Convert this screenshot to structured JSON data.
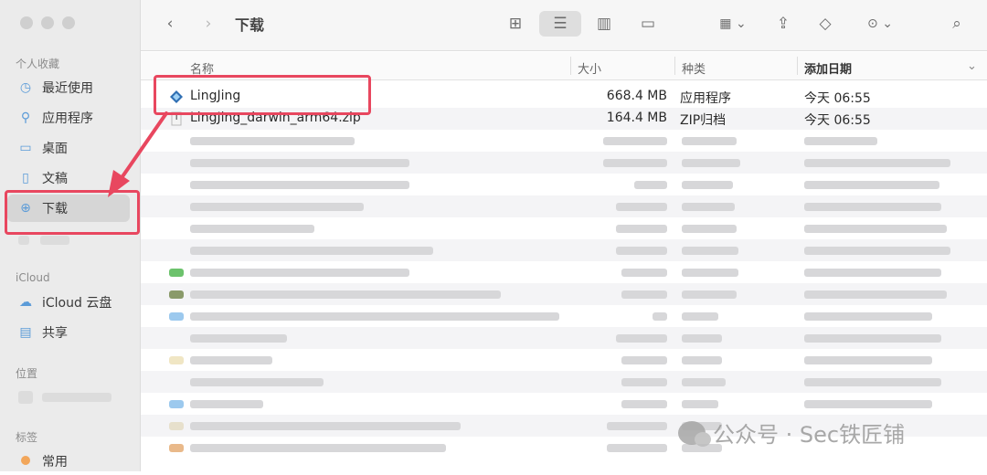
{
  "toolbar": {
    "title": "下载",
    "icons": [
      "back-icon",
      "forward-icon",
      "icon-view-icon",
      "list-view-icon",
      "column-view-icon",
      "gallery-view-icon",
      "group-icon",
      "share-icon",
      "tag-icon",
      "more-icon",
      "search-icon"
    ]
  },
  "sidebar": {
    "favorites_header": "个人收藏",
    "favorites": [
      {
        "label": "最近使用",
        "icon": "clock-icon"
      },
      {
        "label": "应用程序",
        "icon": "apps-icon"
      },
      {
        "label": "桌面",
        "icon": "desktop-icon"
      },
      {
        "label": "文稿",
        "icon": "document-icon"
      },
      {
        "label": "下载",
        "icon": "download-icon"
      }
    ],
    "icloud_header": "iCloud",
    "icloud": [
      {
        "label": "iCloud 云盘",
        "icon": "cloud-icon"
      },
      {
        "label": "共享",
        "icon": "shared-folder-icon"
      }
    ],
    "locations_header": "位置",
    "tags_header": "标签",
    "tags": [
      {
        "label": "常用",
        "color": "#f2a65a"
      }
    ]
  },
  "columns": {
    "name": "名称",
    "size": "大小",
    "kind": "种类",
    "date": "添加日期"
  },
  "files": [
    {
      "name": "LingJing",
      "size": "668.4 MB",
      "kind": "应用程序",
      "date": "今天 06:55",
      "icon": "app-icon"
    },
    {
      "name": "LingJing_darwin_arm64.zip",
      "size": "164.4 MB",
      "kind": "ZIP归档",
      "date": "今天 06:55",
      "icon": "zip-icon"
    }
  ],
  "watermark": {
    "text": "公众号 · Sec铁匠铺"
  },
  "colors": {
    "highlight": "#e8475f",
    "accent": "#5b9bd8"
  }
}
